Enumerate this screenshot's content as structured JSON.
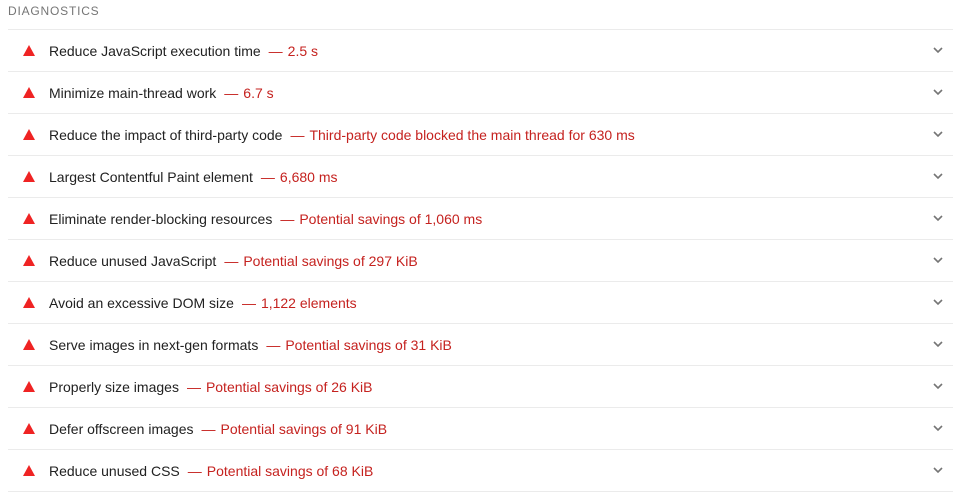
{
  "section": {
    "title": "DIAGNOSTICS"
  },
  "colors": {
    "warning": "#ef2323",
    "value_text": "#c5221f",
    "divider": "#ebebeb",
    "chevron": "#757575"
  },
  "audits": [
    {
      "title": "Reduce JavaScript execution time",
      "separator": "—",
      "value": "2.5 s",
      "icon": "warning-triangle-icon"
    },
    {
      "title": "Minimize main-thread work",
      "separator": "—",
      "value": "6.7 s",
      "icon": "warning-triangle-icon"
    },
    {
      "title": "Reduce the impact of third-party code",
      "separator": "—",
      "value": "Third-party code blocked the main thread for 630 ms",
      "icon": "warning-triangle-icon"
    },
    {
      "title": "Largest Contentful Paint element",
      "separator": "—",
      "value": "6,680 ms",
      "icon": "warning-triangle-icon"
    },
    {
      "title": "Eliminate render-blocking resources",
      "separator": "—",
      "value": "Potential savings of 1,060 ms",
      "icon": "warning-triangle-icon"
    },
    {
      "title": "Reduce unused JavaScript",
      "separator": "—",
      "value": "Potential savings of 297 KiB",
      "icon": "warning-triangle-icon"
    },
    {
      "title": "Avoid an excessive DOM size",
      "separator": "—",
      "value": "1,122 elements",
      "icon": "warning-triangle-icon"
    },
    {
      "title": "Serve images in next-gen formats",
      "separator": "—",
      "value": "Potential savings of 31 KiB",
      "icon": "warning-triangle-icon"
    },
    {
      "title": "Properly size images",
      "separator": "—",
      "value": "Potential savings of 26 KiB",
      "icon": "warning-triangle-icon"
    },
    {
      "title": "Defer offscreen images",
      "separator": "—",
      "value": "Potential savings of 91 KiB",
      "icon": "warning-triangle-icon"
    },
    {
      "title": "Reduce unused CSS",
      "separator": "—",
      "value": "Potential savings of 68 KiB",
      "icon": "warning-triangle-icon"
    }
  ]
}
